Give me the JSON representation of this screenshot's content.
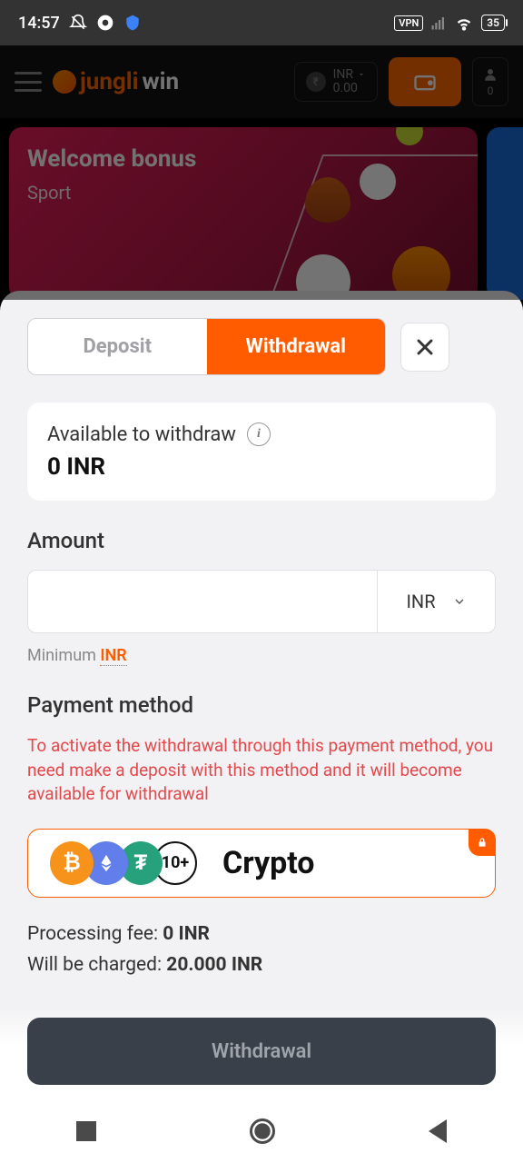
{
  "statusbar": {
    "time": "14:57",
    "vpn": "VPN",
    "battery": "35"
  },
  "header": {
    "logo_a": "jungli",
    "logo_b": "win",
    "currency": "INR",
    "balance": "0.00",
    "user_count": "0"
  },
  "banner": {
    "title": "Welcome bonus",
    "subtitle": "Sport"
  },
  "tabs": {
    "deposit": "Deposit",
    "withdrawal": "Withdrawal"
  },
  "available": {
    "label": "Available to withdraw",
    "value": "0 INR"
  },
  "amount": {
    "label": "Amount",
    "currency": "INR",
    "min_prefix": "Minimum ",
    "min_link": "INR"
  },
  "payment": {
    "label": "Payment method",
    "warning": "To activate the withdrawal through this payment method, you need make a deposit with this method and it will become available for withdrawal",
    "method_name": "Crypto",
    "more": "10+"
  },
  "fees": {
    "fee_label": "Processing fee: ",
    "fee_value": "0 INR",
    "charge_label": "Will be charged: ",
    "charge_value": "20.000 INR"
  },
  "cta": {
    "withdraw": "Withdrawal"
  }
}
